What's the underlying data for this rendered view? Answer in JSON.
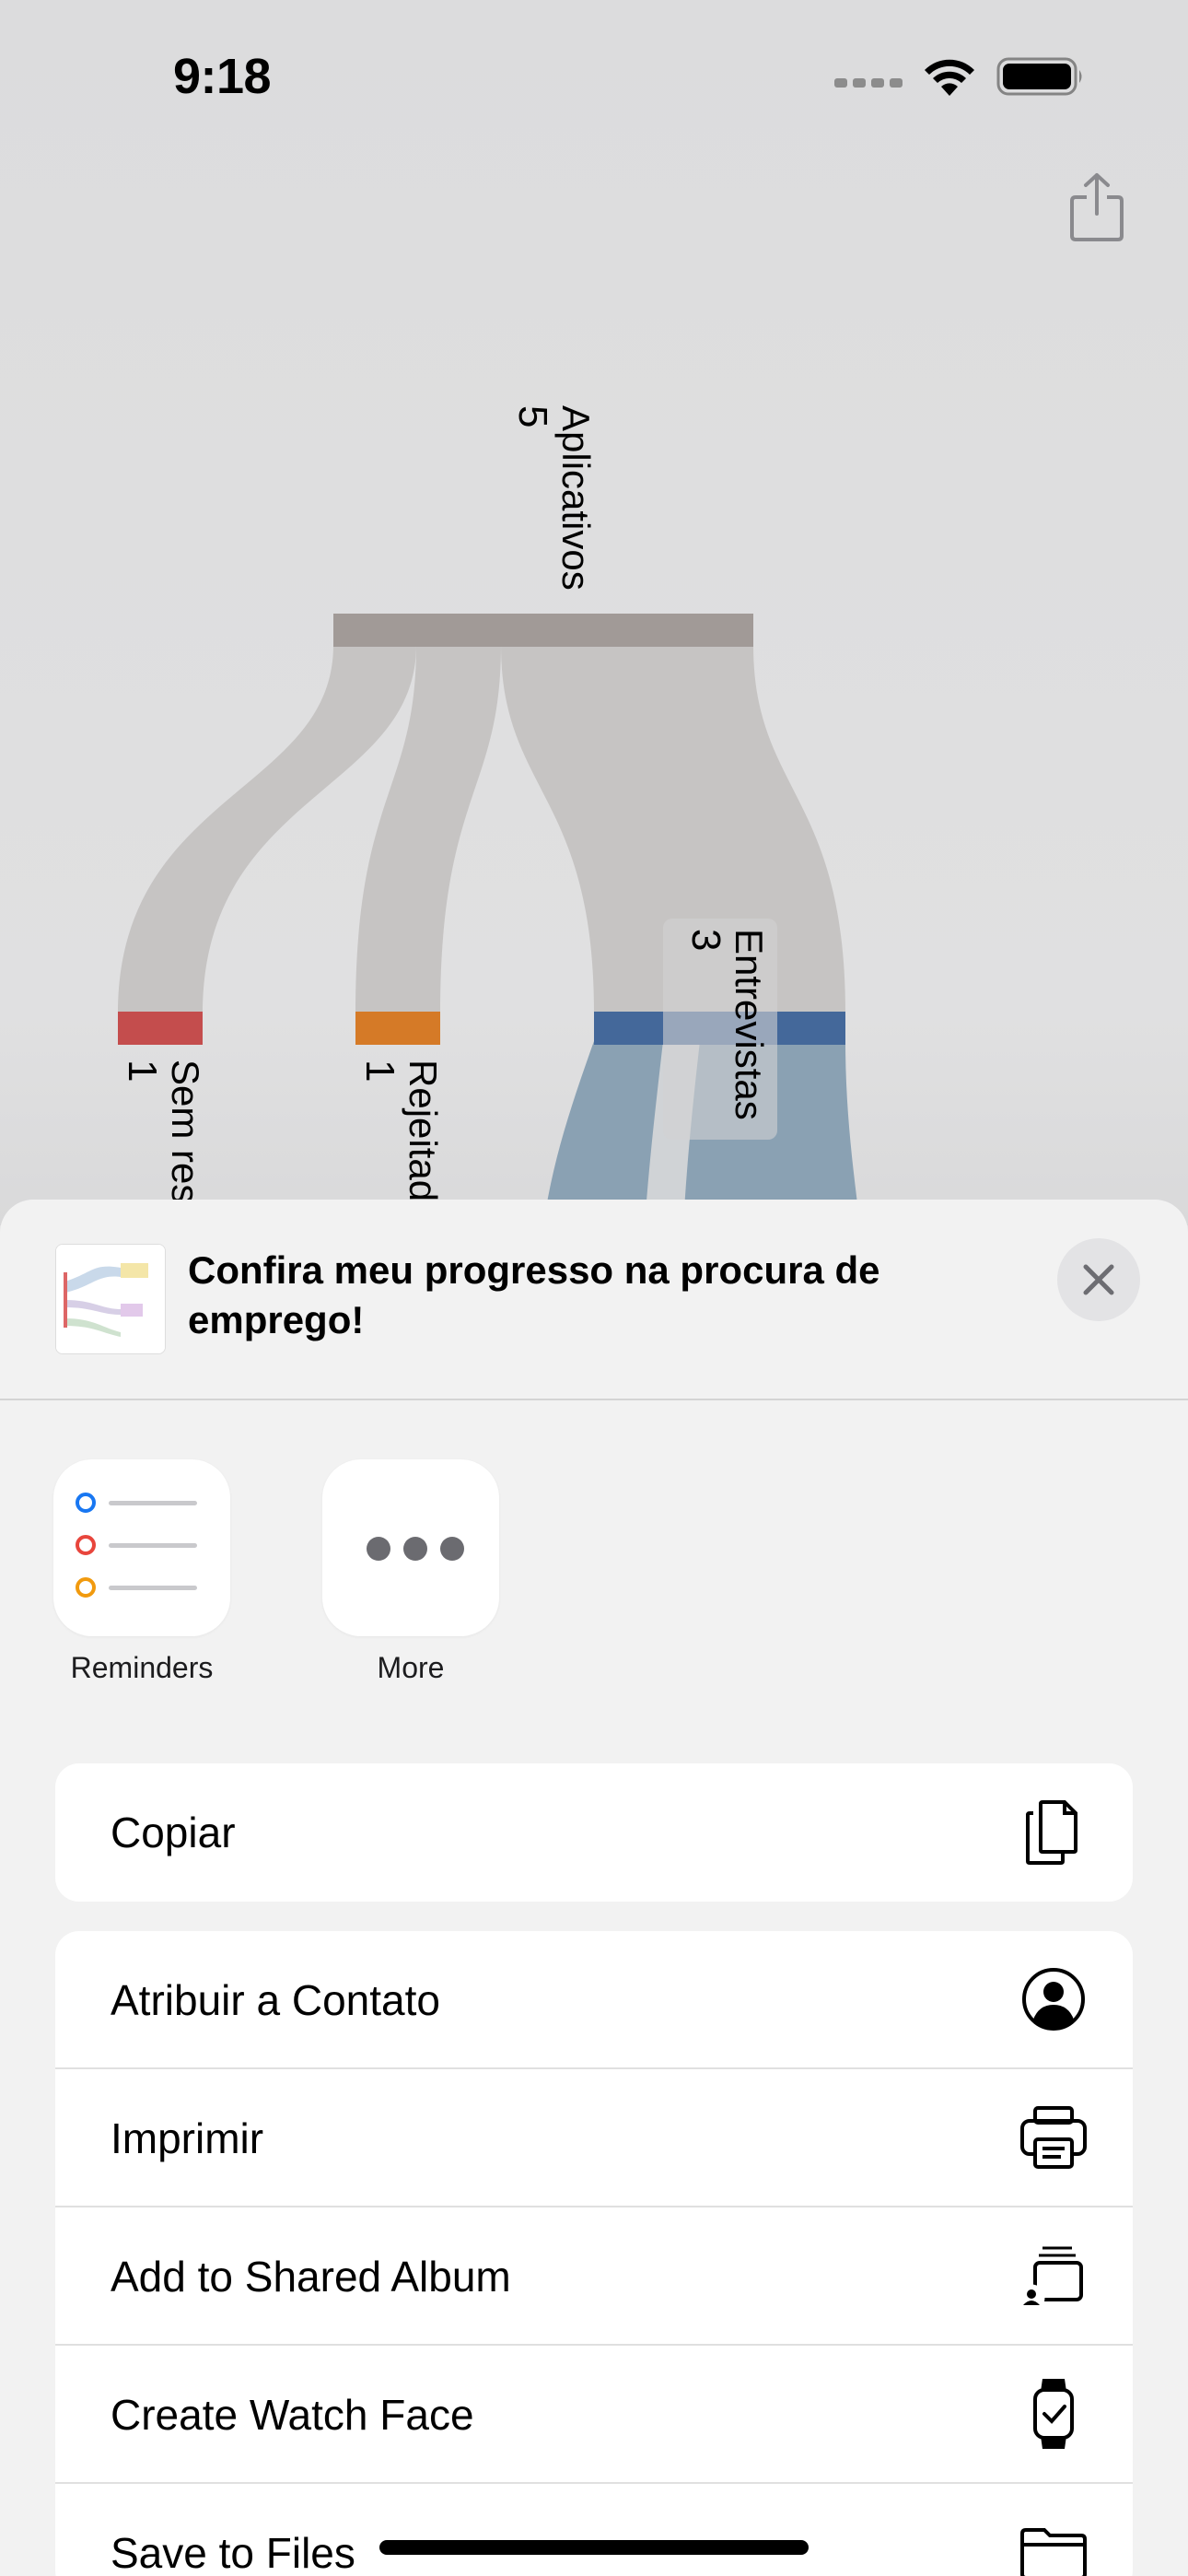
{
  "status_bar": {
    "time": "9:18"
  },
  "sankey": {
    "nodes": [
      {
        "label": "Aplicativos",
        "value": "5",
        "color": "#a19a97"
      },
      {
        "label": "Sem resposta",
        "value": "1",
        "color": "#c44d4d"
      },
      {
        "label": "Rejeitado",
        "value": "1",
        "color": "#d57a27"
      },
      {
        "label": "Entrevistas",
        "value": "3",
        "color": "#44689a"
      }
    ]
  },
  "share_sheet": {
    "title": "Confira meu progresso na procura de emprego!",
    "apps": [
      {
        "label": "Reminders",
        "icon": "reminders-icon"
      },
      {
        "label": "More",
        "icon": "more-icon"
      }
    ],
    "actions_group1": [
      {
        "label": "Copiar",
        "icon": "copy-icon"
      }
    ],
    "actions_group2": [
      {
        "label": "Atribuir a Contato",
        "icon": "contact-icon"
      },
      {
        "label": "Imprimir",
        "icon": "printer-icon"
      },
      {
        "label": "Add to Shared Album",
        "icon": "shared-album-icon"
      },
      {
        "label": "Create Watch Face",
        "icon": "watch-icon"
      },
      {
        "label": "Save to Files",
        "icon": "folder-icon"
      }
    ]
  }
}
